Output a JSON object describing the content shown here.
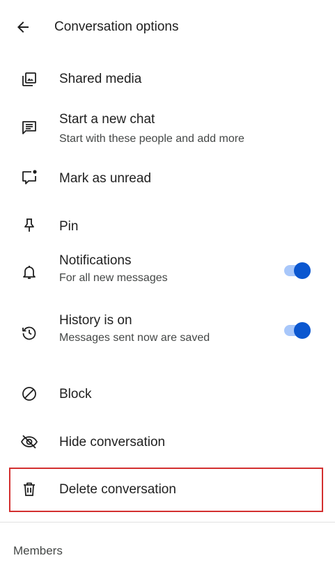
{
  "header": {
    "back_icon": "arrow-left-icon",
    "title": "Conversation options"
  },
  "options": [
    {
      "label": "Shared media",
      "icon": "photo-library-icon"
    },
    {
      "label": "Start a new chat",
      "sublabel": "Start with these people and add more",
      "icon": "chat-icon"
    },
    {
      "label": "Mark as unread",
      "icon": "mark-unread-icon"
    },
    {
      "label": "Pin",
      "icon": "pin-icon"
    },
    {
      "label": "Notifications",
      "sublabel": "For all new messages",
      "icon": "bell-icon",
      "toggle": true
    },
    {
      "label": "History is on",
      "sublabel": "Messages sent now are saved",
      "icon": "history-icon",
      "toggle": true
    },
    {
      "label": "Block",
      "icon": "block-icon"
    },
    {
      "label": "Hide conversation",
      "icon": "eye-off-icon"
    },
    {
      "label": "Delete conversation",
      "icon": "trash-icon",
      "highlighted": true
    }
  ],
  "section": {
    "members_label": "Members"
  },
  "colors": {
    "accent": "#0b57d0",
    "toggle_track": "#a8c7fa",
    "highlight": "#d32f2f",
    "text": "#1f1f1f",
    "secondary_text": "#444746"
  }
}
